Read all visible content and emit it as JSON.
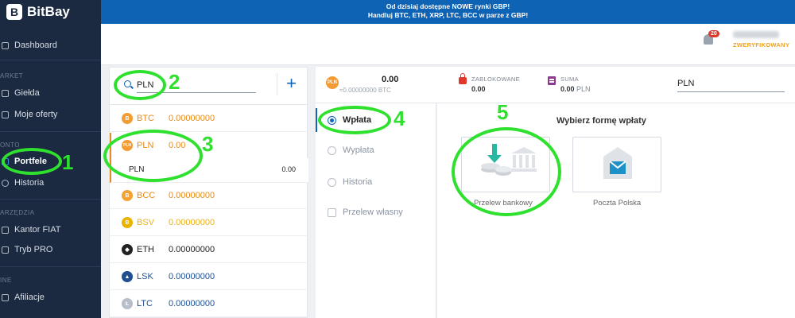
{
  "app": {
    "logo_text": "BitBay",
    "logo_mark": "B"
  },
  "banner": {
    "line1": "Od dzisiaj dostępne NOWE rynki GBP!",
    "line2": "Handluj BTC, ETH, XRP, LTC, BCC w parze z GBP!"
  },
  "sidebar": {
    "dashboard": "Dashboard",
    "section_market": "ARKET",
    "gielda": "Giełda",
    "moje_oferty": "Moje oferty",
    "section_konto": "ONTO",
    "portfele": "Portfele",
    "historia": "Historia",
    "section_narzedzia": "ARZĘDZIA",
    "kantor_fiat": "Kantor FIAT",
    "tryb_pro": "Tryb PRO",
    "section_inne": "INE",
    "afiliacje": "Afiliacje"
  },
  "header": {
    "notification_count": "20",
    "verified": "ZWERYFIKOWANY"
  },
  "wallet_list": {
    "search_value": "PLN",
    "add_label": "+",
    "coins": [
      {
        "icon": "B",
        "symbol": "BTC",
        "balance": "0.00000000",
        "color": "#e58b1a",
        "bg": "#f39c34"
      },
      {
        "icon": "PLN",
        "symbol": "PLN",
        "balance": "0.00",
        "color": "#e58b1a",
        "bg": "#f39c34"
      },
      {
        "icon": "B",
        "symbol": "BCC",
        "balance": "0.00000000",
        "color": "#e58b1a",
        "bg": "#f3a233"
      },
      {
        "icon": "B",
        "symbol": "BSV",
        "balance": "0.00000000",
        "color": "#e8b21c",
        "bg": "#eab300"
      },
      {
        "icon": "◆",
        "symbol": "ETH",
        "balance": "0.00000000",
        "color": "#222222",
        "bg": "#222222"
      },
      {
        "icon": "▲",
        "symbol": "LSK",
        "balance": "0.00000000",
        "color": "#1f4f8f",
        "bg": "#1f4f8f"
      },
      {
        "icon": "Ł",
        "symbol": "LTC",
        "balance": "0.00000000",
        "color": "#1f4f8f",
        "bg": "#b7bec8"
      }
    ],
    "sub_row": {
      "label": "PLN",
      "value": "0.00"
    }
  },
  "summary": {
    "coin_icon": "PLN",
    "amount": "0.00",
    "sub_amount": "≈0.00000000",
    "sub_unit": "BTC",
    "blocked_label": "ZABLOKOWANE",
    "blocked_value": "0.00",
    "sum_label": "SUMA",
    "sum_value": "0.00",
    "sum_unit": "PLN",
    "currency": "PLN"
  },
  "actions": {
    "wplata": "Wpłata",
    "wyplata": "Wypłata",
    "historia": "Historia",
    "przelew_wlasny": "Przelew własny"
  },
  "methods": {
    "title": "Wybierz formę wpłaty",
    "bank": "Przelew bankowy",
    "post": "Poczta Polska"
  },
  "annotations": {
    "n1": "1",
    "n2": "2",
    "n3": "3",
    "n4": "4",
    "n5": "5"
  },
  "colors": {
    "sidebar_bg": "#1b2a41",
    "banner_bg": "#0e63b5",
    "accent": "#0e63b5",
    "annotation": "#2fe02f",
    "pln_orange": "#f39c34"
  }
}
